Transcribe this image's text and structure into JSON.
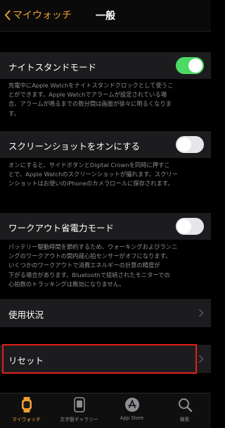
{
  "nav": {
    "back_label": "マイウォッチ",
    "title": "一般"
  },
  "night_stand": {
    "label": "ナイトスタンドモード",
    "enabled": true,
    "description": [
      "充電中にApple Watchをナイトスタンドクロックとして使うこ",
      "とができます。Apple Watchでアラームが設定されている場",
      "合、アラームが鳴るまでの数分間は画面が徐々に明るくなりま",
      "す。"
    ]
  },
  "screenshot": {
    "label": "スクリーンショットをオンにする",
    "enabled": false,
    "description": [
      "オンにすると、サイドボタンとDigital Crownを同時に押すこ",
      "とで、Apple Watchのスクリーンショットが撮れます。スクリー",
      "ンショットはお使いのiPhoneのカメラロールに保存されます。"
    ]
  },
  "workout": {
    "label": "ワークアウト省電力モード",
    "enabled": false,
    "description": [
      "バッテリー駆動時間を節約するため、ウォーキングおよびランニ",
      "ングのワークアウトの間内蔵心拍センサーがオフになります。",
      "いくつかのワークアウトで消費エネルギーの計算の精度が",
      "下がる場合があります。Bluetoothで接続されたモニターでの",
      "心拍数のトラッキングは無効になりません。"
    ]
  },
  "usage": {
    "label": "使用状況"
  },
  "reset": {
    "label": "リセット"
  },
  "tabs": [
    {
      "label": "マイウォッチ",
      "icon": "watch-icon",
      "active": true
    },
    {
      "label": "文字盤ギャラリー",
      "icon": "face-gallery-icon",
      "active": false
    },
    {
      "label": "App Store",
      "icon": "app-store-icon",
      "active": false
    },
    {
      "label": "検索",
      "icon": "search-icon",
      "active": false
    }
  ],
  "colors": {
    "accent": "#f0a030",
    "toggle_on": "#4cd964",
    "highlight": "#e0201e"
  }
}
